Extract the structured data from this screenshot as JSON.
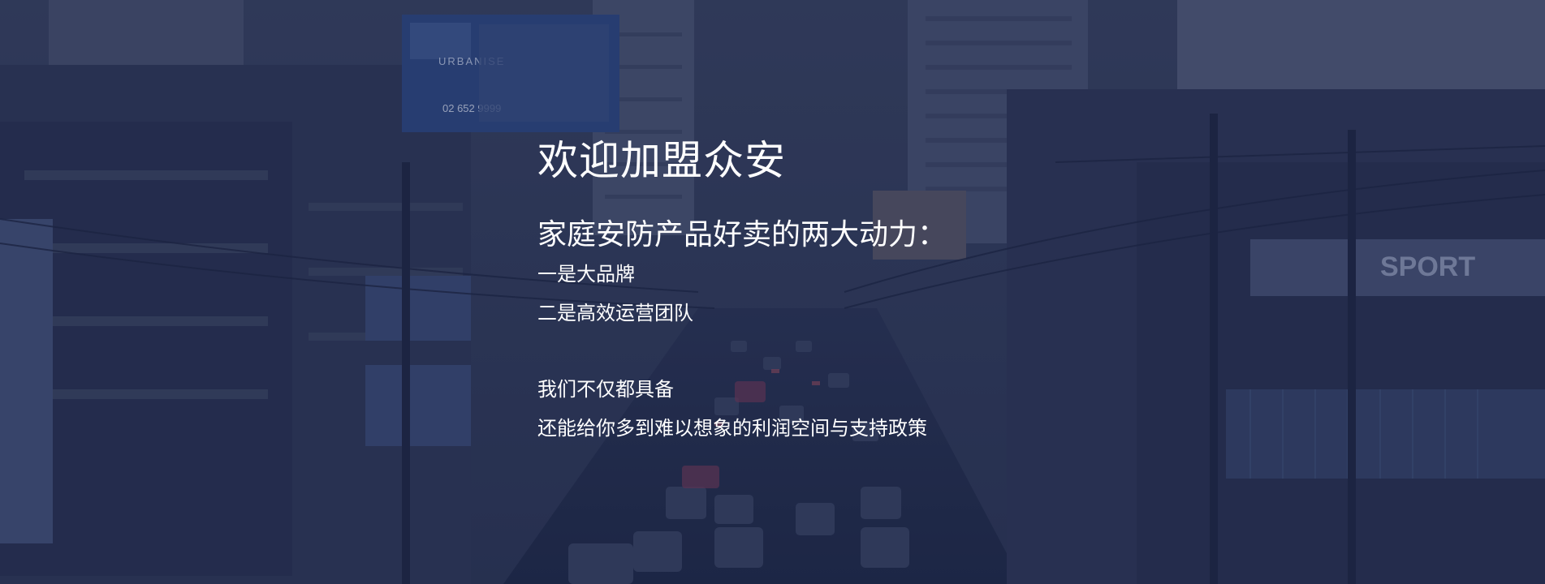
{
  "hero": {
    "title": "欢迎加盟众安",
    "subtitle": "家庭安防产品好卖的两大动力：",
    "points": [
      "一是大品牌",
      "二是高效运营团队"
    ],
    "closing": [
      "我们不仅都具备",
      "还能给你多到难以想象的利润空间与支持政策"
    ]
  },
  "background": {
    "billboard_brand": "URBANISE",
    "billboard_phone": "02 652 9999",
    "sign_sport": "SPORT"
  }
}
